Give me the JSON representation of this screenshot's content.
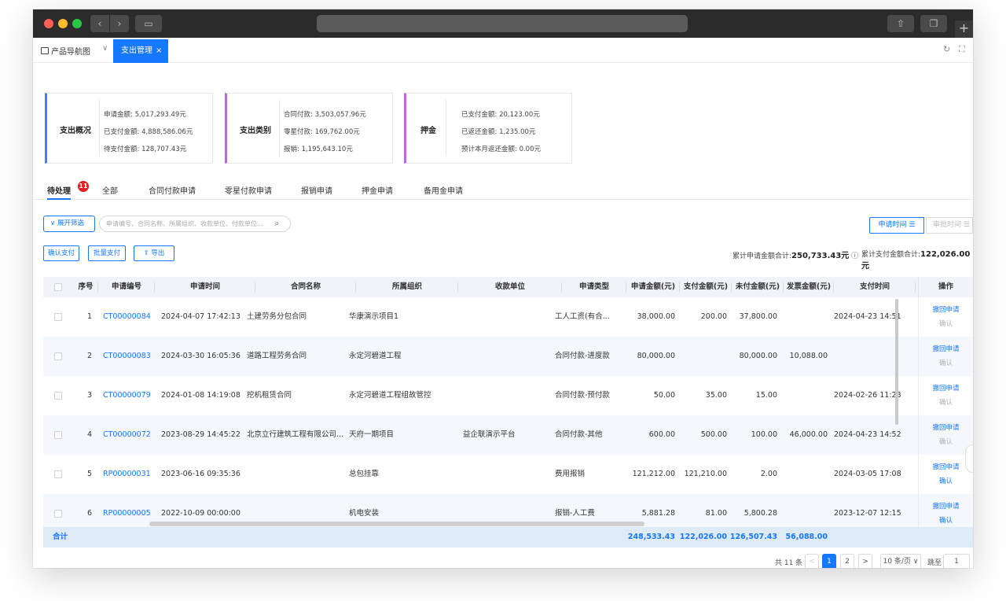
{
  "app_tabs": {
    "home": "产品导航图",
    "active": "支出管理",
    "close": "×"
  },
  "cards": [
    {
      "title": "支出概况",
      "lines": [
        "申请金额: 5,017,293.49元",
        "已支付金额: 4,888,586.06元",
        "待支付金额: 128,707.43元"
      ],
      "accent": "#3b82f6"
    },
    {
      "title": "支出类别",
      "lines": [
        "合同付款: 3,503,057.96元",
        "零星付款: 169,762.00元",
        "报销: 1,195,643.10元"
      ],
      "accent": "#b86bd9"
    },
    {
      "title": "押金",
      "lines": [
        "已支付金额: 20,123.00元",
        "已返还金额: 1,235.00元",
        "预计本月返还金额: 0.00元"
      ],
      "accent": "#b86bd9"
    }
  ],
  "tabs": [
    "待处理",
    "全部",
    "合同付款申请",
    "零星付款申请",
    "报销申请",
    "押金申请",
    "备用金申请"
  ],
  "pending_badge": "11",
  "filter": {
    "expand_label": "展开筛选",
    "search_placeholder": "申请编号、合同名称、所属组织、收款单位、付款单位..."
  },
  "sort": {
    "apply_time": "申请时间",
    "approve_time": "审批时间"
  },
  "actions": {
    "confirm_pay": "确认支付",
    "batch_pay": "批量支付",
    "export": "导出"
  },
  "totals": {
    "apply_label": "累计申请金额合计:",
    "apply_value": "250,733.43元",
    "paid_label": "累计支付金额合计:",
    "paid_value": "122,026.00元"
  },
  "table": {
    "headers": [
      "序号",
      "申请编号",
      "申请时间",
      "合同名称",
      "所属组织",
      "收款单位",
      "申请类型",
      "申请金额(元)",
      "支付金额(元)",
      "未付金额(元)",
      "发票金额(元)",
      "支付时间",
      "操作"
    ],
    "rows": [
      {
        "no": "1",
        "code": "CT00000084",
        "time": "2024-04-07 17:42:13",
        "contract": "土建劳务分包合同",
        "org": "华康演示项目1",
        "payee": "",
        "type": "工人工资(有合...",
        "apply": "38,000.00",
        "paid": "200.00",
        "unpaid": "37,800.00",
        "invoice": "",
        "pay_time": "2024-04-23 14:51",
        "op1": "撤回申请",
        "op2": "确认",
        "op2_active": false
      },
      {
        "no": "2",
        "code": "CT00000083",
        "time": "2024-03-30 16:05:36",
        "contract": "道路工程劳务合同",
        "org": "永定河碧道工程",
        "payee": "",
        "type": "合同付款-进度款",
        "apply": "80,000.00",
        "paid": "",
        "unpaid": "80,000.00",
        "invoice": "10,088.00",
        "pay_time": "",
        "op1": "撤回申请",
        "op2": "确认",
        "op2_active": false
      },
      {
        "no": "3",
        "code": "CT00000079",
        "time": "2024-01-08 14:19:08",
        "contract": "挖机租赁合同",
        "org": "永定河碧道工程组故管控",
        "payee": "",
        "type": "合同付款-预付款",
        "apply": "50.00",
        "paid": "35.00",
        "unpaid": "15.00",
        "invoice": "",
        "pay_time": "2024-02-26 11:23",
        "op1": "撤回申请",
        "op2": "确认",
        "op2_active": false
      },
      {
        "no": "4",
        "code": "CT00000072",
        "time": "2023-08-29 14:45:22",
        "contract": "北京立行建筑工程有限公司...",
        "org": "天府一期项目",
        "payee": "益企联演示平台",
        "type": "合同付款-其他",
        "apply": "600.00",
        "paid": "500.00",
        "unpaid": "100.00",
        "invoice": "46,000.00",
        "pay_time": "2024-04-23 14:52",
        "op1": "撤回申请",
        "op2": "确认",
        "op2_active": false
      },
      {
        "no": "5",
        "code": "RP00000031",
        "time": "2023-06-16 09:35:36",
        "contract": "",
        "org": "总包挂靠",
        "payee": "",
        "type": "费用报销",
        "apply": "121,212.00",
        "paid": "121,210.00",
        "unpaid": "2.00",
        "invoice": "",
        "pay_time": "2024-03-05 17:08",
        "op1": "撤回申请",
        "op2": "确认",
        "op2_active": true
      },
      {
        "no": "6",
        "code": "RP00000005",
        "time": "2022-10-09 00:00:00",
        "contract": "",
        "org": "机电安装",
        "payee": "",
        "type": "报销-人工费",
        "apply": "5,881.28",
        "paid": "81.00",
        "unpaid": "5,800.28",
        "invoice": "",
        "pay_time": "2023-12-07 12:15",
        "op1": "撤回申请",
        "op2": "确认",
        "op2_active": true
      }
    ],
    "summary": {
      "label": "合计",
      "apply": "248,533.43",
      "paid": "122,026.00",
      "unpaid": "126,507.43",
      "invoice": "56,088.00"
    }
  },
  "pagination": {
    "total": "共 11 条",
    "prev": "<",
    "pages": [
      "1",
      "2"
    ],
    "next": ">",
    "page_size": "10 条/页",
    "jump_label": "跳至",
    "jump_value": "1"
  }
}
